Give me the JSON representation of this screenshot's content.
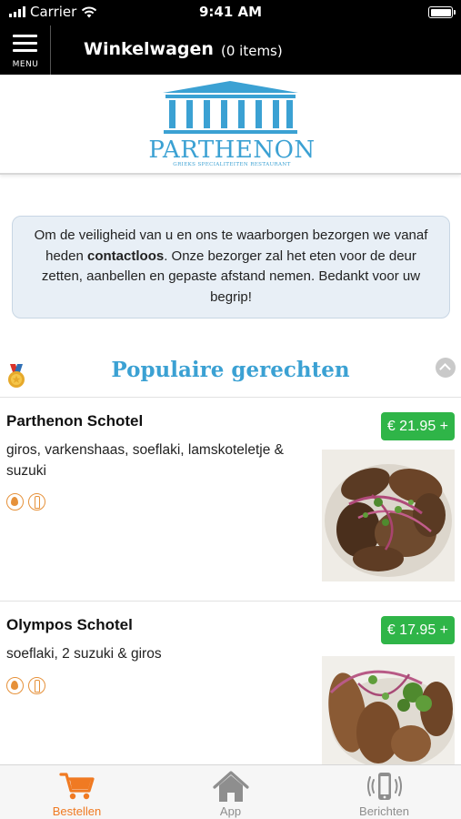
{
  "status_bar": {
    "carrier": "Carrier",
    "time": "9:41 AM"
  },
  "header": {
    "menu_label": "MENU",
    "title": "Winkelwagen",
    "cart_count": "(0 items)"
  },
  "logo": {
    "name": "PARTHENON",
    "tagline": "GRIEKS SPECIALITEITEN RESTAURANT",
    "color": "#3ba1d3"
  },
  "notice": {
    "text_before": "Om de veiligheid van u en ons te waarborgen bezorgen we vanaf heden ",
    "text_bold": "contactloos",
    "text_after": ". Onze bezorger zal het eten voor de deur zetten, aanbellen en gepaste afstand nemen. Bedankt voor uw begrip!"
  },
  "section": {
    "title": "Populaire gerechten",
    "icon": "medal-icon",
    "collapse_icon": "chevron-up-icon"
  },
  "dishes": [
    {
      "name": "Parthenon Schotel",
      "description": "giros, varkenshaas, soeflaki, lamskoteletje & suzuki",
      "price": "€ 21.95 +",
      "icons": [
        "spicy-icon",
        "alcohol-icon"
      ]
    },
    {
      "name": "Olympos Schotel",
      "description": "soeflaki, 2 suzuki & giros",
      "price": "€ 17.95 +",
      "icons": [
        "spicy-icon",
        "alcohol-icon"
      ]
    }
  ],
  "tabbar": {
    "tabs": [
      {
        "label": "Bestellen",
        "icon": "cart-icon",
        "active": true
      },
      {
        "label": "App",
        "icon": "home-icon",
        "active": false
      },
      {
        "label": "Berichten",
        "icon": "phone-vibrate-icon",
        "active": false
      }
    ]
  },
  "colors": {
    "accent": "#f07a22",
    "price_green": "#2fb548",
    "brand_blue": "#3ba1d3",
    "header_bg": "#000000"
  }
}
